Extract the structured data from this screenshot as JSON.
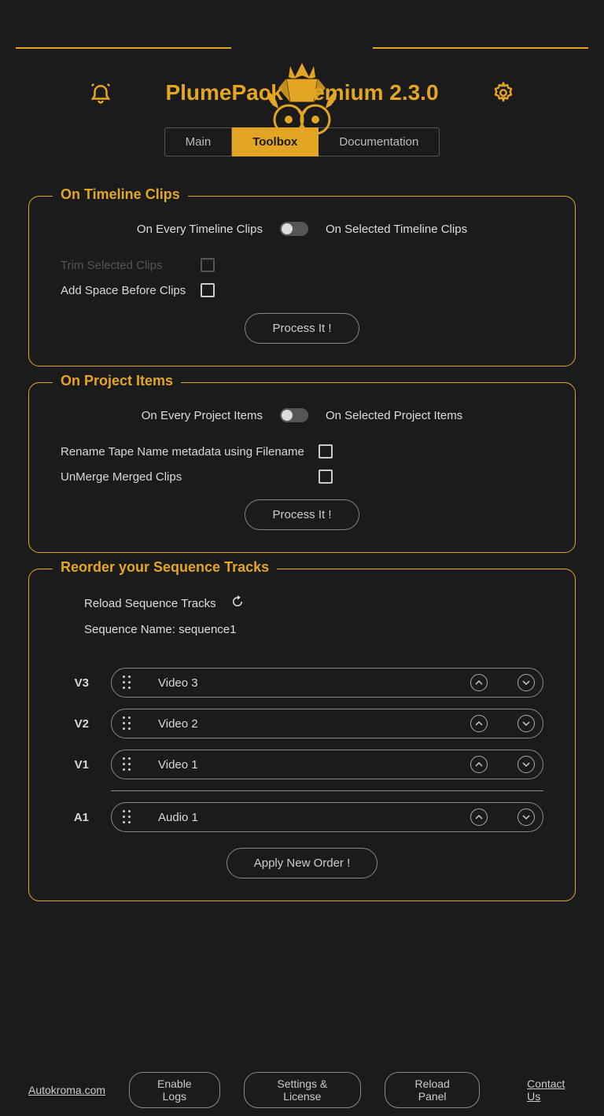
{
  "title": "PlumePack Premium 2.3.0",
  "icons": {
    "bell": "bell-icon",
    "gear": "gear-icon"
  },
  "tabs": [
    {
      "label": "Main",
      "active": false
    },
    {
      "label": "Toolbox",
      "active": true
    },
    {
      "label": "Documentation",
      "active": false
    }
  ],
  "timeline_panel": {
    "title": "On Timeline Clips",
    "toggle_left": "On Every Timeline Clips",
    "toggle_right": "On Selected Timeline Clips",
    "options": [
      {
        "label": "Trim Selected Clips",
        "disabled": true
      },
      {
        "label": "Add Space Before Clips",
        "disabled": false
      }
    ],
    "process": "Process It !"
  },
  "project_panel": {
    "title": "On Project Items",
    "toggle_left": "On Every Project Items",
    "toggle_right": "On Selected Project Items",
    "options": [
      {
        "label": "Rename Tape Name metadata using Filename"
      },
      {
        "label": "UnMerge Merged Clips"
      }
    ],
    "process": "Process It !"
  },
  "reorder_panel": {
    "title": "Reorder your Sequence Tracks",
    "reload_label": "Reload Sequence Tracks",
    "sequence_label": "Sequence Name: sequence1",
    "video_tracks": [
      {
        "id": "V3",
        "name": "Video 3"
      },
      {
        "id": "V2",
        "name": "Video 2"
      },
      {
        "id": "V1",
        "name": "Video 1"
      }
    ],
    "audio_tracks": [
      {
        "id": "A1",
        "name": "Audio 1"
      }
    ],
    "apply": "Apply New Order !"
  },
  "footer": {
    "site": "Autokroma.com",
    "logs": "Enable Logs",
    "settings": "Settings & License",
    "reload": "Reload Panel",
    "contact": "Contact Us"
  }
}
